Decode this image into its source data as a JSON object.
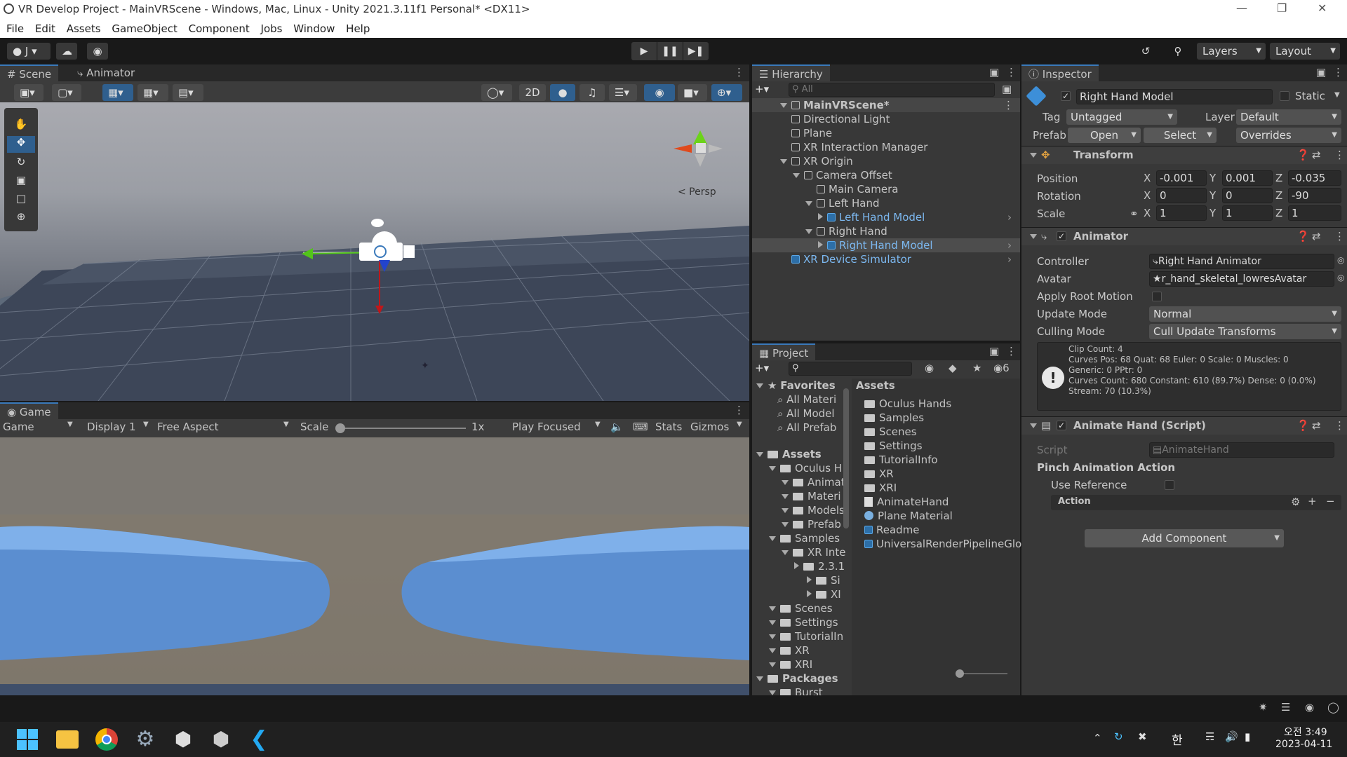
{
  "window": {
    "title": "VR Develop Project - MainVRScene - Windows, Mac, Linux - Unity 2021.3.11f1 Personal* <DX11>"
  },
  "menu": [
    "File",
    "Edit",
    "Assets",
    "GameObject",
    "Component",
    "Jobs",
    "Window",
    "Help"
  ],
  "toolbar": {
    "account": "J",
    "layers": "Layers",
    "layout": "Layout"
  },
  "scene": {
    "tabs": [
      "Scene",
      "Animator"
    ],
    "mode2d": "2D",
    "persp": "< Persp"
  },
  "game": {
    "tab": "Game",
    "display_mode": "Game",
    "display": "Display 1",
    "aspect": "Free Aspect",
    "scale_label": "Scale",
    "scale_value": "1x",
    "play_focused": "Play Focused",
    "stats": "Stats",
    "gizmos": "Gizmos"
  },
  "hierarchy": {
    "tab": "Hierarchy",
    "search_placeholder": "All",
    "scene": "MainVRScene*",
    "items": [
      {
        "label": "Directional Light",
        "indent": 1,
        "prefab": false
      },
      {
        "label": "Plane",
        "indent": 1,
        "prefab": false
      },
      {
        "label": "XR Interaction Manager",
        "indent": 1,
        "prefab": false
      },
      {
        "label": "XR Origin",
        "indent": 1,
        "prefab": false,
        "expanded": true
      },
      {
        "label": "Camera Offset",
        "indent": 2,
        "prefab": false,
        "expanded": true
      },
      {
        "label": "Main Camera",
        "indent": 3,
        "prefab": false
      },
      {
        "label": "Left Hand",
        "indent": 3,
        "prefab": false,
        "expanded": true
      },
      {
        "label": "Left Hand Model",
        "indent": 4,
        "prefab": true
      },
      {
        "label": "Right Hand",
        "indent": 3,
        "prefab": false,
        "expanded": true
      },
      {
        "label": "Right Hand Model",
        "indent": 4,
        "prefab": true,
        "selected": true
      },
      {
        "label": "XR Device Simulator",
        "indent": 1,
        "prefab": true
      }
    ]
  },
  "project": {
    "tab": "Project",
    "hidden_count": "6",
    "favorites_label": "Favorites",
    "favorites": [
      "All Materi",
      "All Model",
      "All Prefab"
    ],
    "tree": [
      {
        "label": "Assets",
        "indent": 0,
        "bold": true
      },
      {
        "label": "Oculus H",
        "indent": 1
      },
      {
        "label": "Animat",
        "indent": 2
      },
      {
        "label": "Materi",
        "indent": 2
      },
      {
        "label": "Models",
        "indent": 2
      },
      {
        "label": "Prefab",
        "indent": 2
      },
      {
        "label": "Samples",
        "indent": 1
      },
      {
        "label": "XR Inte",
        "indent": 2
      },
      {
        "label": "2.3.1",
        "indent": 3
      },
      {
        "label": "Si",
        "indent": 4
      },
      {
        "label": "XI",
        "indent": 4
      },
      {
        "label": "Scenes",
        "indent": 1
      },
      {
        "label": "Settings",
        "indent": 1
      },
      {
        "label": "TutorialIn",
        "indent": 1
      },
      {
        "label": "XR",
        "indent": 1
      },
      {
        "label": "XRI",
        "indent": 1
      },
      {
        "label": "Packages",
        "indent": 0,
        "bold": true
      },
      {
        "label": "Burst",
        "indent": 1
      }
    ],
    "assets_header": "Assets",
    "assets": [
      {
        "label": "Oculus Hands",
        "kind": "folder"
      },
      {
        "label": "Samples",
        "kind": "folder"
      },
      {
        "label": "Scenes",
        "kind": "folder"
      },
      {
        "label": "Settings",
        "kind": "folder"
      },
      {
        "label": "TutorialInfo",
        "kind": "folder"
      },
      {
        "label": "XR",
        "kind": "folder"
      },
      {
        "label": "XRI",
        "kind": "folder"
      },
      {
        "label": "AnimateHand",
        "kind": "script"
      },
      {
        "label": "Plane Material",
        "kind": "material"
      },
      {
        "label": "Readme",
        "kind": "asset"
      },
      {
        "label": "UniversalRenderPipelineGlo",
        "kind": "asset"
      }
    ]
  },
  "inspector": {
    "tab": "Inspector",
    "object_name": "Right Hand Model",
    "static": "Static",
    "tag_label": "Tag",
    "tag": "Untagged",
    "layer_label": "Layer",
    "layer": "Default",
    "prefab_label": "Prefab",
    "open": "Open",
    "select": "Select",
    "overrides": "Overrides",
    "transform": {
      "title": "Transform",
      "position_label": "Position",
      "rotation_label": "Rotation",
      "scale_label": "Scale",
      "position": [
        "-0.001",
        "0.001",
        "-0.035"
      ],
      "rotation": [
        "0",
        "0",
        "-90"
      ],
      "scale": [
        "1",
        "1",
        "1"
      ],
      "axes": [
        "X",
        "Y",
        "Z"
      ]
    },
    "animator": {
      "title": "Animator",
      "controller_label": "Controller",
      "controller": "Right Hand Animator",
      "avatar_label": "Avatar",
      "avatar": "r_hand_skeletal_lowresAvatar",
      "apply_root_motion": "Apply Root Motion",
      "update_mode_label": "Update Mode",
      "update_mode": "Normal",
      "culling_mode_label": "Culling Mode",
      "culling_mode": "Cull Update Transforms",
      "info": [
        "Clip Count: 4",
        "Curves Pos: 68 Quat: 68 Euler: 0 Scale: 0 Muscles: 0",
        "Generic: 0 PPtr: 0",
        "Curves Count: 680 Constant: 610 (89.7%) Dense: 0 (0.0%)",
        "Stream: 70 (10.3%)"
      ]
    },
    "animate_hand": {
      "title": "Animate Hand (Script)",
      "script_label": "Script",
      "script": "AnimateHand",
      "pinch_label": "Pinch Animation Action",
      "use_reference": "Use Reference",
      "action": "Action"
    },
    "add_component": "Add Component"
  },
  "taskbar": {
    "ime": "한",
    "time": "오전 3:49",
    "date": "2023-04-11"
  },
  "colors": {
    "accent": "#3a79bb",
    "prefab_blue": "#5aa8e8",
    "selected_row": "#2c5d87",
    "panel": "#383838",
    "hand_blue": "#4f7fc0"
  }
}
